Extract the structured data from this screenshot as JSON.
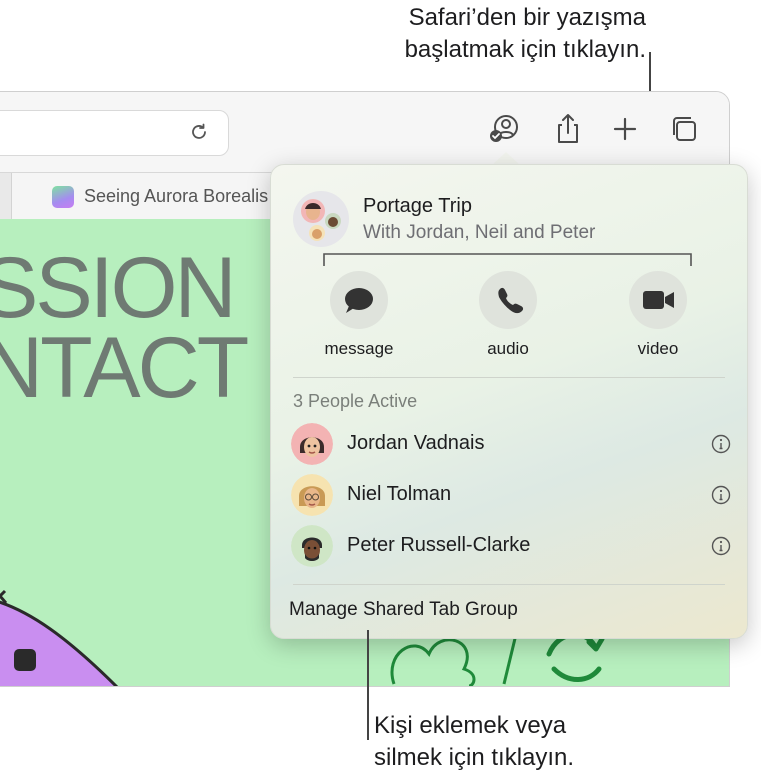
{
  "callouts": {
    "top_line1": "Safari’den bir yazışma",
    "top_line2": "başlatmak için tıklayın.",
    "bottom_line1": "Kişi eklemek veya",
    "bottom_line2": "silmek için tıklayın."
  },
  "browser": {
    "tab_title": "Seeing Aurora Borealis",
    "hero_line1": "SSION",
    "hero_line2": "NTACT"
  },
  "popover": {
    "group_name": "Portage Trip",
    "group_members": "With Jordan, Neil and Peter",
    "actions": [
      {
        "label": "message",
        "icon": "message-bubble-icon"
      },
      {
        "label": "audio",
        "icon": "phone-icon"
      },
      {
        "label": "video",
        "icon": "video-camera-icon"
      }
    ],
    "active_title": "3 People Active",
    "people": [
      {
        "name": "Jordan Vadnais"
      },
      {
        "name": "Niel Tolman"
      },
      {
        "name": "Peter Russell-Clarke"
      }
    ],
    "manage_label": "Manage Shared Tab Group"
  },
  "colors": {
    "webpage_bg": "#b7efbe",
    "icon_gray": "#4a4a4a"
  }
}
